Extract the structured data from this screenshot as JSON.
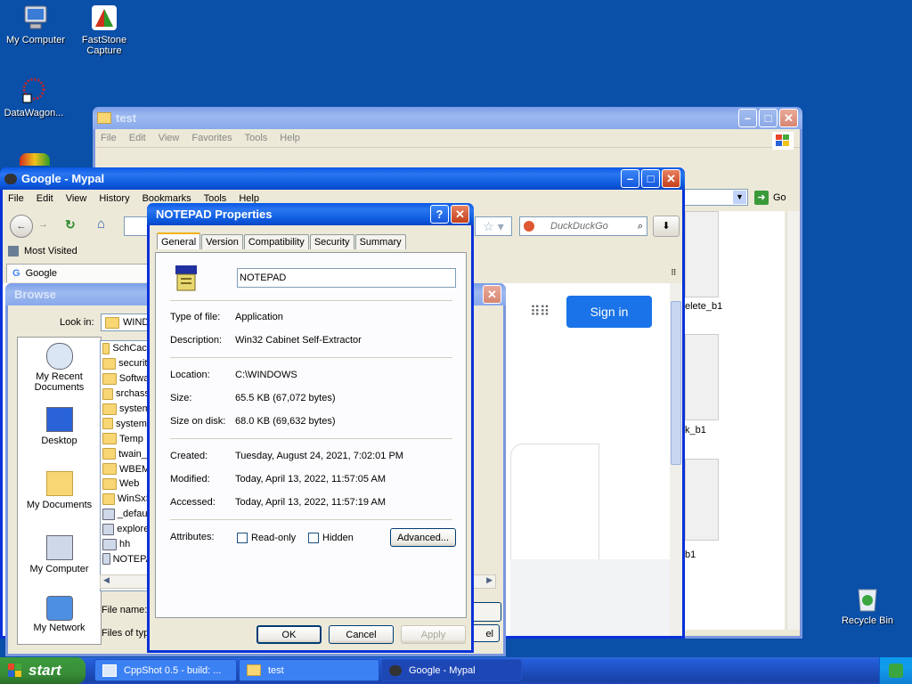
{
  "desktop": {
    "icons": [
      "My Computer",
      "FastStone Capture",
      "DataWagon...",
      "Recycle Bin"
    ]
  },
  "test_window": {
    "title": "test",
    "menu": [
      "File",
      "Edit",
      "View",
      "Favorites",
      "Tools",
      "Help"
    ],
    "go_label": "Go",
    "files": [
      "elete_b1",
      "k_b1",
      "b1"
    ]
  },
  "mypal_window": {
    "title": "Google - Mypal",
    "menu": [
      "File",
      "Edit",
      "View",
      "History",
      "Bookmarks",
      "Tools",
      "Help"
    ],
    "bookmark": "Most Visited",
    "tab_label": "Google",
    "search_placeholder": "DuckDuckGo",
    "sign_in": "Sign in"
  },
  "browse_window": {
    "title": "Browse",
    "look_in_label": "Look in:",
    "look_in_value": "WIND",
    "places": [
      "My Recent Documents",
      "Desktop",
      "My Documents",
      "My Computer",
      "My Network"
    ],
    "files": [
      "SchCach",
      "security",
      "Softwar",
      "srchasst",
      "system",
      "system3",
      "Temp",
      "twain_3",
      "WBEM",
      "Web",
      "WinSxS",
      "_default",
      "explorer",
      "hh",
      "NOTEPA"
    ],
    "file_name_label": "File name:",
    "files_of_type_label": "Files of type"
  },
  "dialog": {
    "title": "NOTEPAD Properties",
    "tabs": [
      "General",
      "Version",
      "Compatibility",
      "Security",
      "Summary"
    ],
    "name_value": "NOTEPAD",
    "type_label": "Type of file:",
    "type_value": "Application",
    "desc_label": "Description:",
    "desc_value": "Win32 Cabinet Self-Extractor",
    "location_label": "Location:",
    "location_value": "C:\\WINDOWS",
    "size_label": "Size:",
    "size_value": "65.5 KB (67,072 bytes)",
    "size_on_disk_label": "Size on disk:",
    "size_on_disk_value": "68.0 KB (69,632 bytes)",
    "created_label": "Created:",
    "created_value": "Tuesday, August 24, 2021, 7:02:01 PM",
    "modified_label": "Modified:",
    "modified_value": "Today, April 13, 2022, 11:57:05 AM",
    "accessed_label": "Accessed:",
    "accessed_value": "Today, April 13, 2022, 11:57:19 AM",
    "attributes_label": "Attributes:",
    "readonly_label": "Read-only",
    "hidden_label": "Hidden",
    "advanced_label": "Advanced...",
    "ok_label": "OK",
    "cancel_label": "Cancel",
    "apply_label": "Apply"
  },
  "taskbar": {
    "start_label": "start",
    "tasks": [
      "CppShot 0.5 - build: ...",
      "test",
      "Google - Mypal"
    ]
  }
}
